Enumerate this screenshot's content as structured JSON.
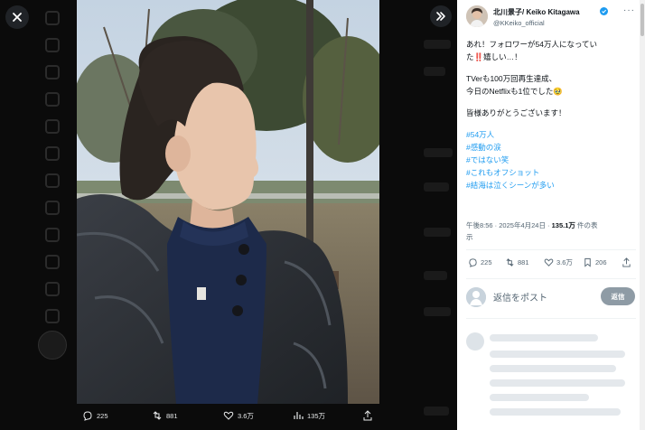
{
  "modal": {
    "close_icon": "close-icon",
    "expand_icon": "chevron-double-right-icon"
  },
  "media_bar": {
    "replies": "225",
    "reposts": "881",
    "likes": "3.6万",
    "views": "135万"
  },
  "author": {
    "display_name": "北川景子/ Keiko Kitagawa",
    "handle": "@KKeiko_official",
    "more_label": "···"
  },
  "tweet": {
    "lines": [
      "あれ！フォロワーが54万人になってい",
      "た‼️嬉しい…！",
      "",
      "TVerも100万回再生達成、",
      "今日のNetflixも1位でした🥹",
      "",
      "皆様ありがとうございます！",
      ""
    ],
    "hashtags": [
      "#54万人",
      "#感動の涙",
      "#ではない笑",
      "#これもオフショット",
      "#結海は泣くシーンが多い"
    ],
    "timestamp": "午後8:56 · 2025年4月24日 · ",
    "view_count": "135.1万",
    "view_suffix": " 件の表",
    "view_suffix2": "示"
  },
  "actions": {
    "replies": "225",
    "reposts": "881",
    "likes": "3.6万",
    "bookmarks": "206"
  },
  "reply": {
    "placeholder": "返信をポスト",
    "button_label": "返信"
  },
  "colors": {
    "accent": "#1d9bf0",
    "text": "#0f1419",
    "muted": "#536471",
    "reply_button": "#8e9ba5"
  }
}
